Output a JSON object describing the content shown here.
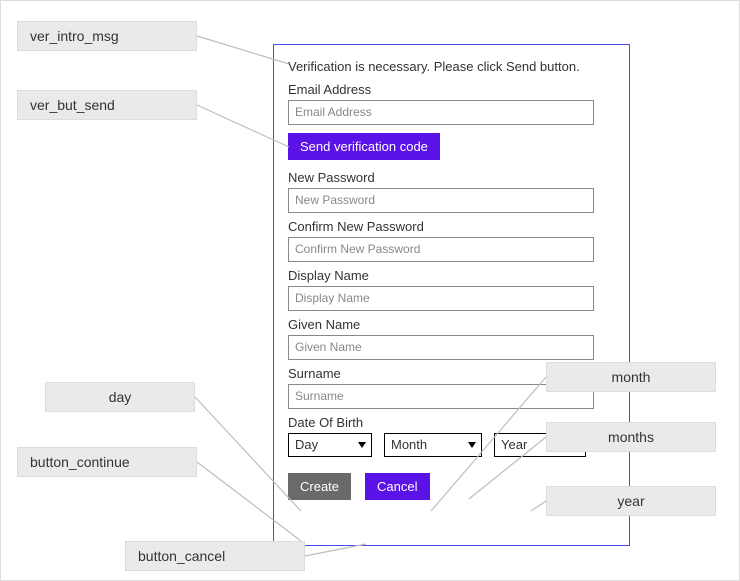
{
  "form": {
    "intro_msg": "Verification is necessary. Please click Send button.",
    "email_label": "Email Address",
    "email_placeholder": "Email Address",
    "send_btn_label": "Send verification code",
    "newpw_label": "New Password",
    "newpw_placeholder": "New Password",
    "confirmpw_label": "Confirm New Password",
    "confirmpw_placeholder": "Confirm New Password",
    "display_label": "Display Name",
    "display_placeholder": "Display Name",
    "given_label": "Given Name",
    "given_placeholder": "Given Name",
    "surname_label": "Surname",
    "surname_placeholder": "Surname",
    "dob_label": "Date Of Birth",
    "day_selected": "Day",
    "month_selected": "Month",
    "year_selected": "Year",
    "create_label": "Create",
    "cancel_label": "Cancel"
  },
  "callouts": {
    "ver_intro_msg": "ver_intro_msg",
    "ver_but_send": "ver_but_send",
    "day": "day",
    "button_continue": "button_continue",
    "button_cancel": "button_cancel",
    "month": "month",
    "months": "months",
    "year": "year"
  },
  "colors": {
    "panel_border": "#4a4ae8",
    "accent": "#5a12e6",
    "callout_bg": "#eaeaea"
  }
}
